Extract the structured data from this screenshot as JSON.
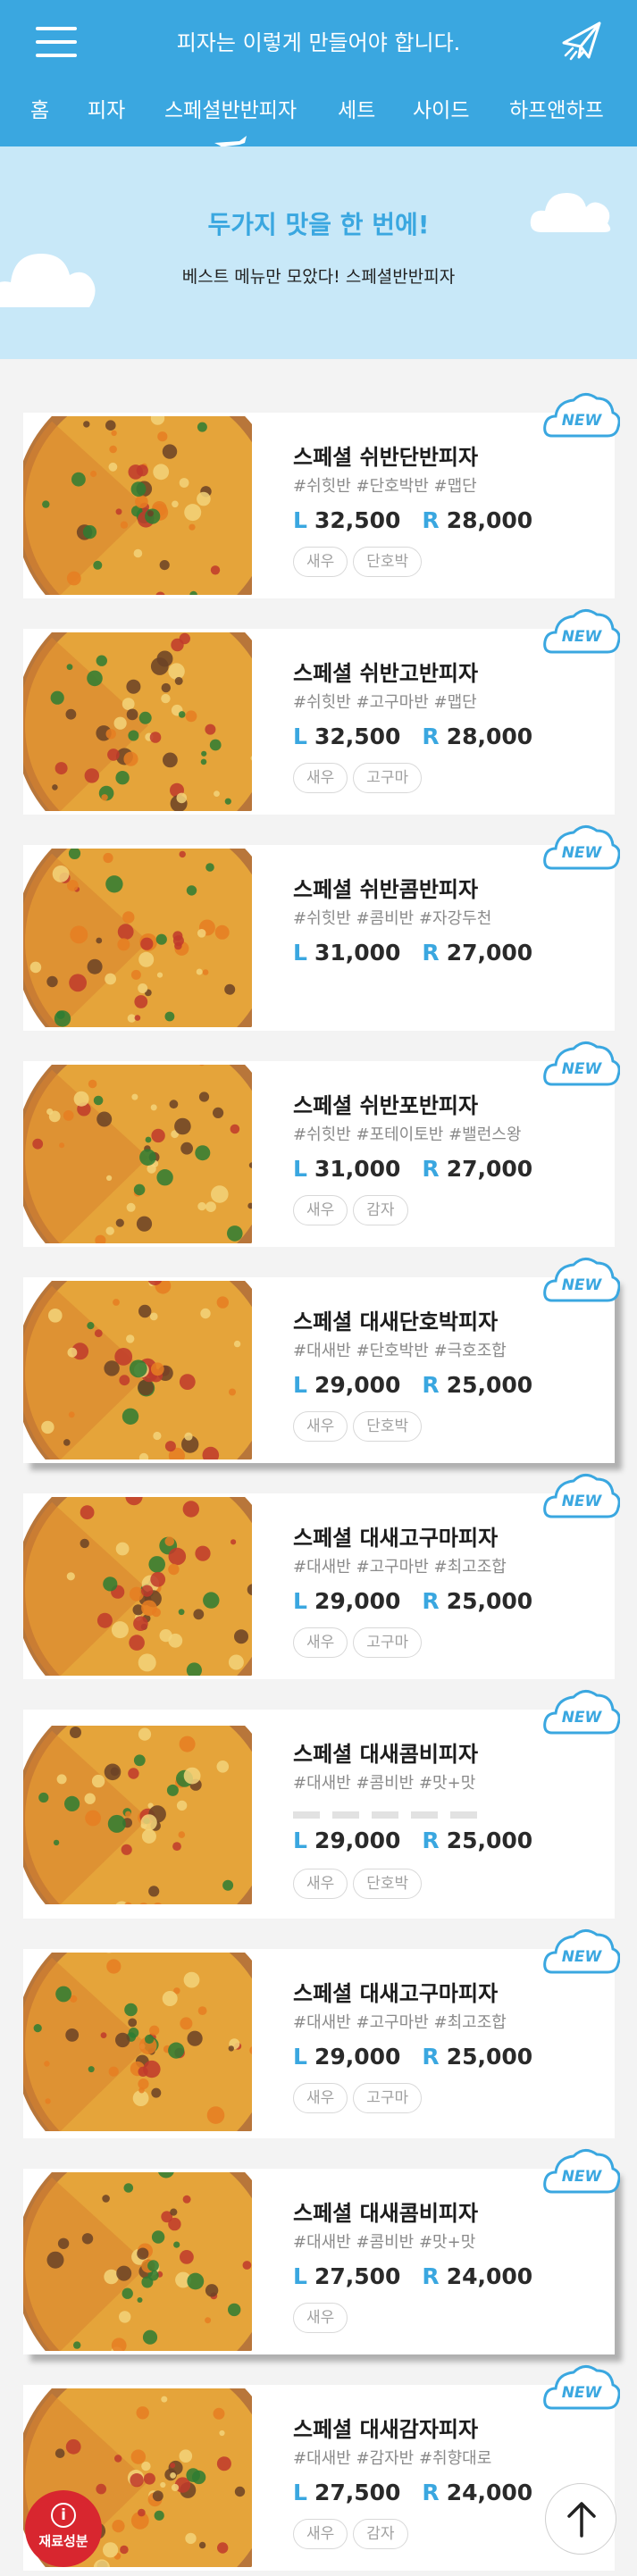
{
  "header": {
    "title": "피자는 이렇게 만들어야 합니다.",
    "menu_icon": "hamburger-menu-icon",
    "plane_icon": "paper-plane-icon",
    "accent_color": "#3aa7e0"
  },
  "nav": {
    "items": [
      "홈",
      "피자",
      "스페셜반반피자",
      "세트",
      "사이드",
      "하프앤하프"
    ],
    "active_index": 2
  },
  "hero": {
    "title": "두가지 맛을 한 번에!",
    "subtitle": "베스트 메뉴만 모았다! 스페셜반반피자"
  },
  "badge_label": "NEW",
  "products": [
    {
      "name": "스페셜 쉬반단반피자",
      "tags": "#쉬힛반 #단호박반 #맵단",
      "l_label": "L",
      "l_price": "32,500",
      "r_label": "R",
      "r_price": "28,000",
      "chips": [
        "새우",
        "단호박"
      ]
    },
    {
      "name": "스페셜 쉬반고반피자",
      "tags": "#쉬힛반 #고구마반 #맵단",
      "l_label": "L",
      "l_price": "32,500",
      "r_label": "R",
      "r_price": "28,000",
      "chips": [
        "새우",
        "고구마"
      ]
    },
    {
      "name": "스페셜 쉬반콤반피자",
      "tags": "#쉬힛반 #콤비반 #자강두천",
      "l_label": "L",
      "l_price": "31,000",
      "r_label": "R",
      "r_price": "27,000",
      "chips": []
    },
    {
      "name": "스페셜 쉬반포반피자",
      "tags": "#쉬힛반 #포테이토반 #밸런스왕",
      "l_label": "L",
      "l_price": "31,000",
      "r_label": "R",
      "r_price": "27,000",
      "chips": [
        "새우",
        "감자"
      ]
    },
    {
      "name": "스페셜 대새단호박피자",
      "tags": "#대새반 #단호박반 #극호조합",
      "l_label": "L",
      "l_price": "29,000",
      "r_label": "R",
      "r_price": "25,000",
      "chips": [
        "새우",
        "단호박"
      ]
    },
    {
      "name": "스페셜 대새고구마피자",
      "tags": "#대새반 #고구마반 #최고조합",
      "l_label": "L",
      "l_price": "29,000",
      "r_label": "R",
      "r_price": "25,000",
      "chips": [
        "새우",
        "고구마"
      ]
    },
    {
      "name": "스페셜 대새콤비피자",
      "tags": "#대새반 #콤비반 #맛+맛",
      "l_label": "L",
      "l_price": "29,000",
      "r_label": "R",
      "r_price": "25,000",
      "chips": [
        "새우",
        "단호박"
      ]
    },
    {
      "name": "스페셜 대새고구마피자",
      "tags": "#대새반 #고구마반 #최고조합",
      "l_label": "L",
      "l_price": "29,000",
      "r_label": "R",
      "r_price": "25,000",
      "chips": [
        "새우",
        "고구마"
      ]
    },
    {
      "name": "스페셜 대새콤비피자",
      "tags": "#대새반 #콤비반 #맛+맛",
      "l_label": "L",
      "l_price": "27,500",
      "r_label": "R",
      "r_price": "24,000",
      "chips": [
        "새우"
      ]
    },
    {
      "name": "스페셜 대새감자피자",
      "tags": "#대새반 #감자반 #취향대로",
      "l_label": "L",
      "l_price": "27,500",
      "r_label": "R",
      "r_price": "24,000",
      "chips": [
        "새우",
        "감자"
      ]
    }
  ],
  "fab": {
    "info_label": "재료성분",
    "info_icon": "info-icon",
    "top_icon": "arrow-up-icon"
  }
}
